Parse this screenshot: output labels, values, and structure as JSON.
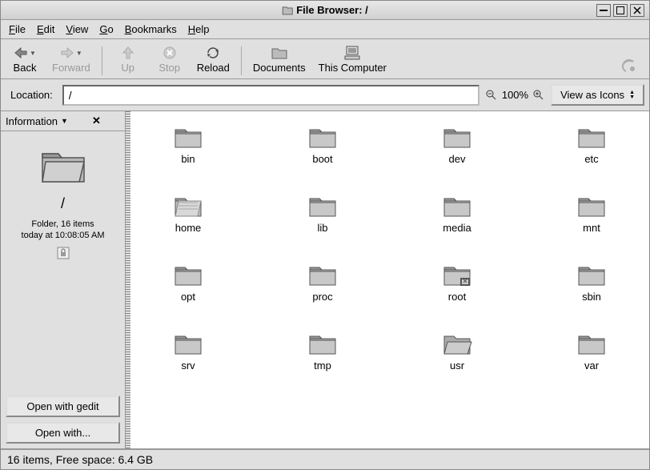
{
  "window": {
    "title": "File Browser: /"
  },
  "menu": {
    "file": "File",
    "edit": "Edit",
    "view": "View",
    "go": "Go",
    "bookmarks": "Bookmarks",
    "help": "Help"
  },
  "toolbar": {
    "back": "Back",
    "forward": "Forward",
    "up": "Up",
    "stop": "Stop",
    "reload": "Reload",
    "documents": "Documents",
    "computer": "This Computer"
  },
  "location": {
    "label": "Location:",
    "value": "/"
  },
  "zoom": {
    "text": "100%"
  },
  "view_selector": {
    "label": "View as Icons"
  },
  "sidepanel": {
    "header": "Information",
    "folder_name": "/",
    "line1": "Folder, 16 items",
    "line2": "today at 10:08:05 AM",
    "open_gedit": "Open with gedit",
    "open_with": "Open with..."
  },
  "files": [
    {
      "name": "bin",
      "kind": "folder"
    },
    {
      "name": "boot",
      "kind": "folder"
    },
    {
      "name": "dev",
      "kind": "folder"
    },
    {
      "name": "etc",
      "kind": "folder"
    },
    {
      "name": "home",
      "kind": "folder-link"
    },
    {
      "name": "lib",
      "kind": "folder"
    },
    {
      "name": "media",
      "kind": "folder"
    },
    {
      "name": "mnt",
      "kind": "folder"
    },
    {
      "name": "opt",
      "kind": "folder"
    },
    {
      "name": "proc",
      "kind": "folder"
    },
    {
      "name": "root",
      "kind": "folder-locked"
    },
    {
      "name": "sbin",
      "kind": "folder"
    },
    {
      "name": "srv",
      "kind": "folder"
    },
    {
      "name": "tmp",
      "kind": "folder"
    },
    {
      "name": "usr",
      "kind": "folder-open"
    },
    {
      "name": "var",
      "kind": "folder"
    }
  ],
  "statusbar": {
    "text": "16 items, Free space: 6.4 GB"
  }
}
